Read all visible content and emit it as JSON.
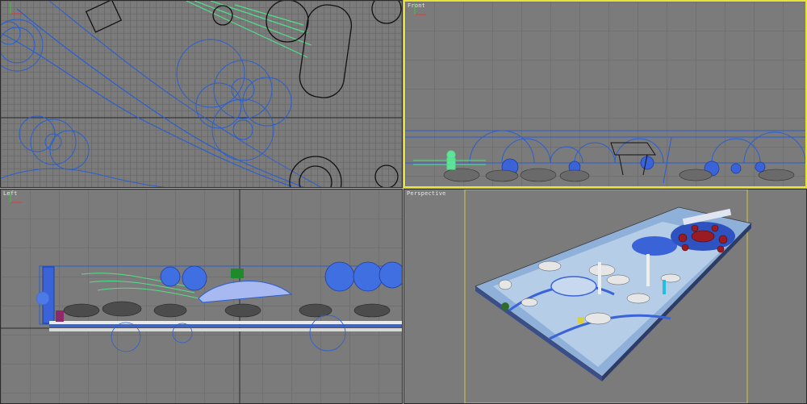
{
  "viewports": {
    "top": {
      "label": ""
    },
    "front": {
      "label": "Front"
    },
    "left": {
      "label": "Left"
    },
    "perspective": {
      "label": "Perspective"
    }
  },
  "colors": {
    "viewport_bg": "#7b7b7b",
    "grid_line": "#6d6d6d",
    "active_border": "#e8e23b",
    "wire_blue": "#2a5fd0",
    "wire_green": "#4fe08a",
    "wire_black": "#111111",
    "world_axis_line": "#2b2b2b"
  },
  "icons": {
    "axis_gizmo": "axis-tripod-icon"
  }
}
